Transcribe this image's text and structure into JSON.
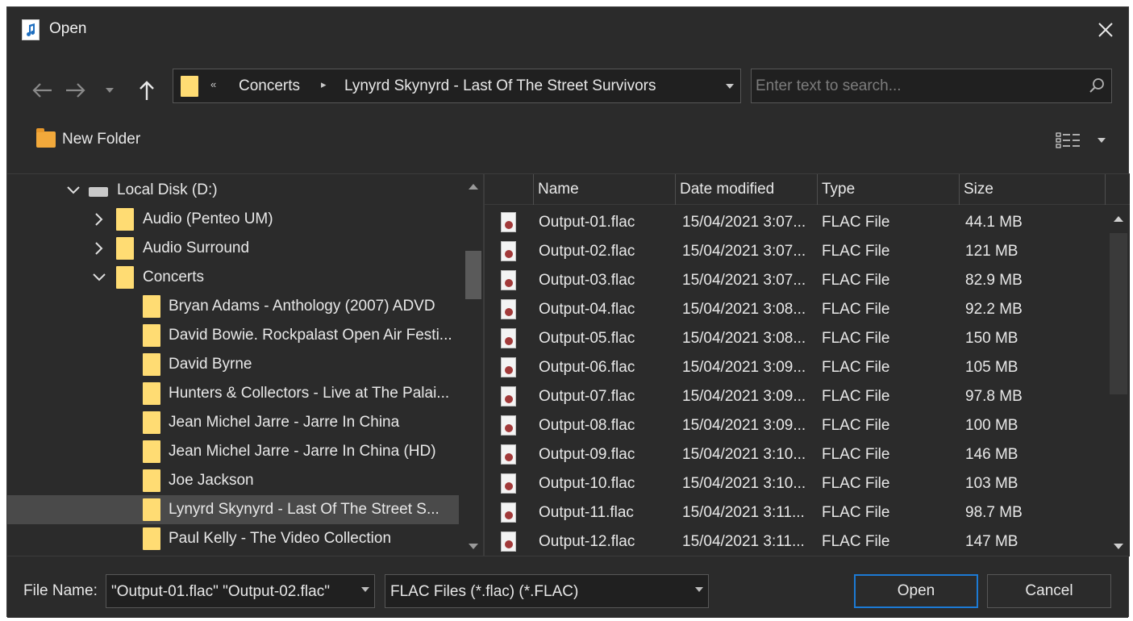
{
  "window": {
    "title": "Open",
    "icon": "music-file-icon"
  },
  "nav": {
    "back_icon": "arrow-left-icon",
    "forward_icon": "arrow-right-icon",
    "recent_icon": "chevron-down-icon",
    "up_icon": "arrow-up-icon"
  },
  "address": {
    "overflow": "«",
    "crumbs": [
      "Concerts",
      "Lynyrd Skynyrd - Last Of The Street Survivors"
    ]
  },
  "search": {
    "placeholder": "Enter text to search..."
  },
  "toolbar": {
    "new_folder": "New Folder",
    "view_icon": "details-view-icon"
  },
  "tree": {
    "items": [
      {
        "label": "Local Disk (D:)",
        "expanded": true
      },
      {
        "label": "Audio (Penteo UM)",
        "expanded": false
      },
      {
        "label": "Audio Surround",
        "expanded": false
      },
      {
        "label": "Concerts",
        "expanded": true
      },
      {
        "label": "Bryan Adams - Anthology (2007) ADVD"
      },
      {
        "label": "David Bowie. Rockpalast Open Air Festi..."
      },
      {
        "label": "David Byrne"
      },
      {
        "label": "Hunters & Collectors - Live at The Palai..."
      },
      {
        "label": "Jean Michel Jarre - Jarre In China"
      },
      {
        "label": "Jean Michel Jarre - Jarre In China (HD)"
      },
      {
        "label": "Joe Jackson"
      },
      {
        "label": "Lynyrd Skynyrd - Last Of The Street S...",
        "selected": true
      },
      {
        "label": "Paul Kelly - The Video Collection"
      }
    ]
  },
  "list": {
    "columns": [
      "Name",
      "Date modified",
      "Type",
      "Size"
    ],
    "rows": [
      [
        "Output-01.flac",
        "15/04/2021 3:07...",
        "FLAC File",
        "44.1 MB"
      ],
      [
        "Output-02.flac",
        "15/04/2021 3:07...",
        "FLAC File",
        "121 MB"
      ],
      [
        "Output-03.flac",
        "15/04/2021 3:07...",
        "FLAC File",
        "82.9 MB"
      ],
      [
        "Output-04.flac",
        "15/04/2021 3:08...",
        "FLAC File",
        "92.2 MB"
      ],
      [
        "Output-05.flac",
        "15/04/2021 3:08...",
        "FLAC File",
        "150 MB"
      ],
      [
        "Output-06.flac",
        "15/04/2021 3:09...",
        "FLAC File",
        "105 MB"
      ],
      [
        "Output-07.flac",
        "15/04/2021 3:09...",
        "FLAC File",
        "97.8 MB"
      ],
      [
        "Output-08.flac",
        "15/04/2021 3:09...",
        "FLAC File",
        "100 MB"
      ],
      [
        "Output-09.flac",
        "15/04/2021 3:10...",
        "FLAC File",
        "146 MB"
      ],
      [
        "Output-10.flac",
        "15/04/2021 3:10...",
        "FLAC File",
        "103 MB"
      ],
      [
        "Output-11.flac",
        "15/04/2021 3:11...",
        "FLAC File",
        "98.7 MB"
      ],
      [
        "Output-12.flac",
        "15/04/2021 3:11...",
        "FLAC File",
        "147 MB"
      ]
    ]
  },
  "footer": {
    "file_name_label": "File Name:",
    "file_name_value": "\"Output-01.flac\" \"Output-02.flac\"",
    "file_type_value": "FLAC Files (*.flac) (*.FLAC)",
    "open_label": "Open",
    "cancel_label": "Cancel"
  },
  "colors": {
    "background": "#2b2b2b",
    "accent": "#1c7ad4",
    "folder": "#ffdc73",
    "selection": "#4a4a4a"
  }
}
